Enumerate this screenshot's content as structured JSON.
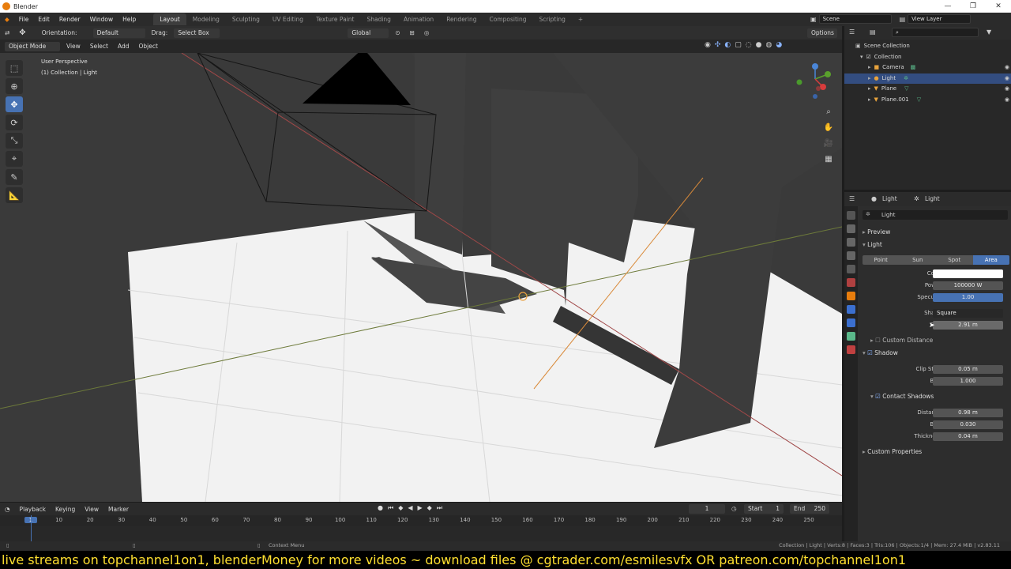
{
  "window": {
    "title": "Blender"
  },
  "menubar": {
    "menus": [
      "File",
      "Edit",
      "Render",
      "Window",
      "Help"
    ],
    "workspaces": [
      "Layout",
      "Modeling",
      "Sculpting",
      "UV Editing",
      "Texture Paint",
      "Shading",
      "Animation",
      "Rendering",
      "Compositing",
      "Scripting"
    ],
    "active_workspace": "Layout",
    "scene": "Scene",
    "view_layer": "View Layer"
  },
  "toolbar": {
    "orientation_label": "Orientation:",
    "orientation_value": "Default",
    "drag_label": "Drag:",
    "drag_value": "Select Box",
    "transform_orientation": "Global",
    "options": "Options"
  },
  "viewport_header": {
    "mode": "Object Mode",
    "menus": [
      "View",
      "Select",
      "Add",
      "Object"
    ]
  },
  "viewport": {
    "perspective": "User Perspective",
    "collection_info": "(1) Collection | Light"
  },
  "outliner": {
    "root": "Scene Collection",
    "collection": "Collection",
    "items": [
      {
        "name": "Camera",
        "color": "#e8a33d",
        "selected": false
      },
      {
        "name": "Light",
        "color": "#e8a33d",
        "selected": true
      },
      {
        "name": "Plane",
        "color": "#e8a33d",
        "selected": false
      },
      {
        "name": "Plane.001",
        "color": "#e8a33d",
        "selected": false
      }
    ]
  },
  "properties": {
    "breadcrumb_object": "Light",
    "breadcrumb_data": "Light",
    "datablock_name": "Light",
    "sections": {
      "preview": "Preview",
      "light": "Light",
      "custom_distance": "Custom Distance",
      "shadow": "Shadow",
      "contact_shadows": "Contact Shadows",
      "custom_properties": "Custom Properties"
    },
    "light_types": [
      "Point",
      "Sun",
      "Spot",
      "Area"
    ],
    "active_light_type": "Area",
    "fields": {
      "color_label": "Color",
      "color_value": "#ffffff",
      "power_label": "Power",
      "power_value": "100000 W",
      "specular_label": "Specular",
      "specular_value": "1.00",
      "shape_label": "Shape",
      "shape_value": "Square",
      "size_label": "Size",
      "size_value": "2.91 m",
      "clip_start_label": "Clip Start",
      "clip_start_value": "0.05 m",
      "bias_label": "Bias",
      "bias_value": "1.000",
      "distance_label": "Distance",
      "distance_value": "0.98 m",
      "cs_bias_label": "Bias",
      "cs_bias_value": "0.030",
      "thickness_label": "Thickness",
      "thickness_value": "0.04 m"
    }
  },
  "timeline": {
    "menus": [
      "Playback",
      "Keying",
      "View",
      "Marker"
    ],
    "current_frame": "1",
    "start_label": "Start",
    "start_value": "1",
    "end_label": "End",
    "end_value": "250",
    "ticks": [
      "1",
      "10",
      "20",
      "30",
      "40",
      "50",
      "60",
      "70",
      "80",
      "90",
      "100",
      "110",
      "120",
      "130",
      "140",
      "150",
      "160",
      "170",
      "180",
      "190",
      "200",
      "210",
      "220",
      "230",
      "240",
      "250"
    ]
  },
  "statusbar": {
    "context_menu": "Context Menu",
    "stats": "Collection | Light | Verts:8 | Faces:3 | Tris:106 | Objects:1/4 | Mem: 27.4 MiB | v2.83.11"
  },
  "banner": {
    "text": "live streams on topchannel1on1,  blenderMoney for more videos ~ download files @ cgtrader.com/esmilesvfx OR patreon.com/topchannel1on1"
  }
}
